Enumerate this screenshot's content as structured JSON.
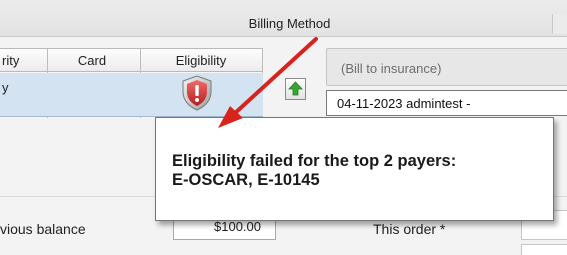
{
  "section": {
    "title": "Billing Method"
  },
  "grid": {
    "columns": [
      "rity",
      "Card",
      "Eligibility"
    ],
    "row": {
      "priority": "y",
      "card": "",
      "eligibility_icon": "warning-shield-icon"
    }
  },
  "billing": {
    "type_placeholder": "(Bill to insurance)",
    "date_value": "04-11-2023 admintest -"
  },
  "totals": {
    "previous_balance_label": "vious balance",
    "previous_balance_value": "$100.00",
    "this_order_label": "This order *"
  },
  "tooltip": {
    "line1": "Eligibility failed for the top 2 payers:",
    "line2": "E-OSCAR, E-10145"
  },
  "colors": {
    "selected_row": "#d3e3f1",
    "annotation_arrow": "#d8231c",
    "shield_red": "#c92b2b",
    "arrow_green": "#3aa535"
  }
}
